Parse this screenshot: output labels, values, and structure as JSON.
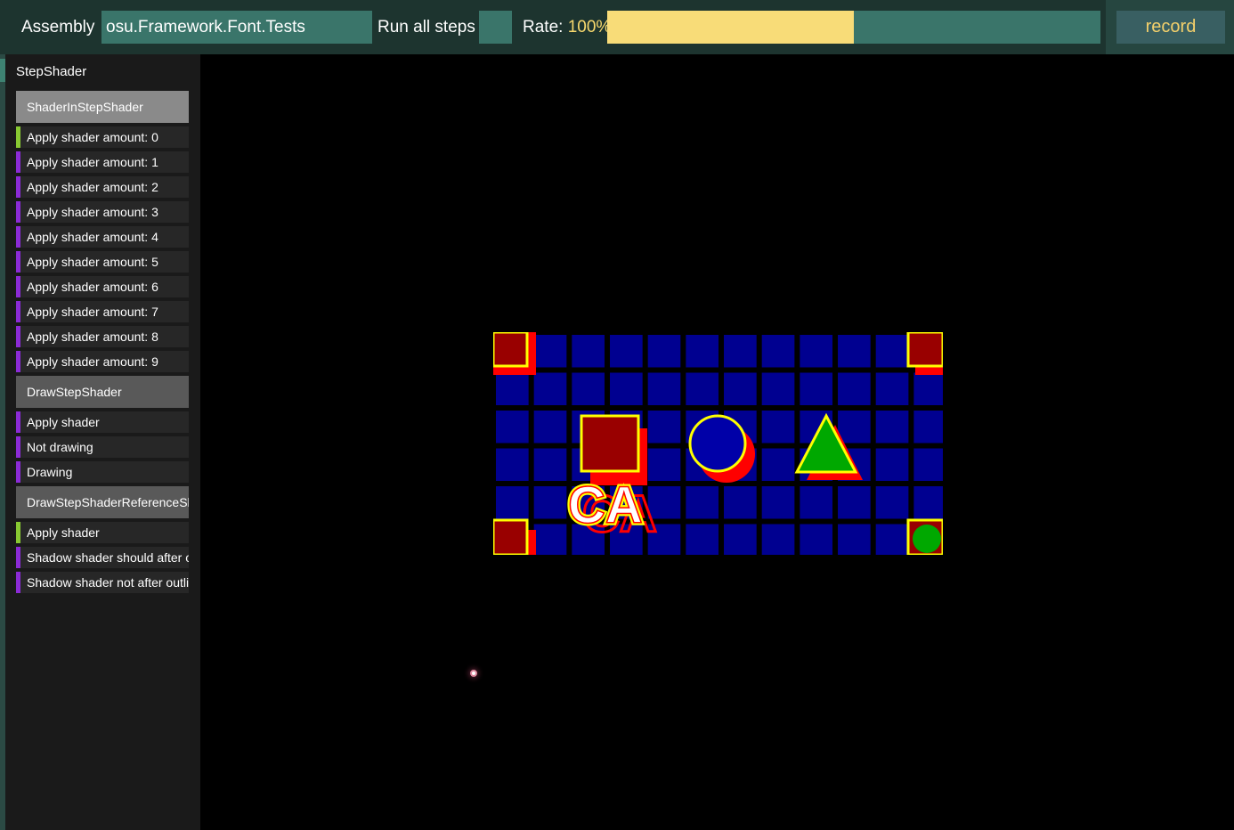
{
  "toolbar": {
    "assembly_label": "Assembly",
    "assembly_value": "osu.Framework.Font.Tests",
    "run_all_label": "Run all steps",
    "rate_label": "Rate:",
    "rate_value": "100%",
    "rate_fraction": 0.5,
    "record_label": "record"
  },
  "sidebar": {
    "scene_title": "StepShader",
    "groups": [
      {
        "header": "ShaderInStepShader",
        "selected": true,
        "steps": [
          {
            "label": "Apply shader amount: 0",
            "status": "passed"
          },
          {
            "label": "Apply shader amount: 1",
            "status": "pending"
          },
          {
            "label": "Apply shader amount: 2",
            "status": "pending"
          },
          {
            "label": "Apply shader amount: 3",
            "status": "pending"
          },
          {
            "label": "Apply shader amount: 4",
            "status": "pending"
          },
          {
            "label": "Apply shader amount: 5",
            "status": "pending"
          },
          {
            "label": "Apply shader amount: 6",
            "status": "pending"
          },
          {
            "label": "Apply shader amount: 7",
            "status": "pending"
          },
          {
            "label": "Apply shader amount: 8",
            "status": "pending"
          },
          {
            "label": "Apply shader amount: 9",
            "status": "pending"
          }
        ]
      },
      {
        "header": "DrawStepShader",
        "selected": false,
        "steps": [
          {
            "label": "Apply shader",
            "status": "pending"
          },
          {
            "label": "Not drawing",
            "status": "pending"
          },
          {
            "label": "Drawing",
            "status": "pending"
          }
        ]
      },
      {
        "header": "DrawStepShaderReferenceShader",
        "selected": false,
        "steps": [
          {
            "label": "Apply shader",
            "status": "passed"
          },
          {
            "label": "Shadow shader should after outline shader",
            "status": "pending"
          },
          {
            "label": "Shadow shader not after outline shader",
            "status": "pending"
          }
        ]
      }
    ]
  },
  "scene": {
    "text": "CA"
  },
  "colors": {
    "toolbar_bg": "#1d342f",
    "input_bg": "#3a756a",
    "rate_fill": "#f8dc78",
    "record_text": "#f4d06b",
    "passed": "#88c932",
    "pending": "#8b2bd6",
    "grid_bg": "#000000",
    "grid_cell": "#000090",
    "shape_red": "#990000",
    "shadow_red": "#ff0000",
    "outline_yellow": "#ffff00",
    "shape_blue": "#0000a8",
    "shape_green": "#00a800"
  }
}
